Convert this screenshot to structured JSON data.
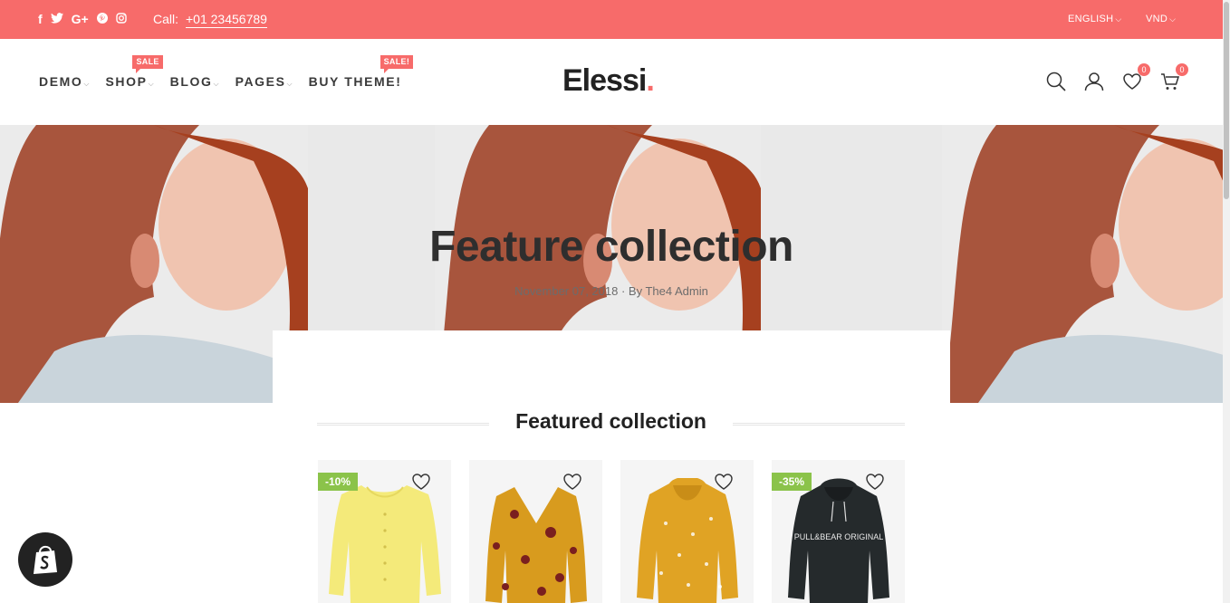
{
  "topbar": {
    "social_icons": [
      "facebook-icon",
      "twitter-icon",
      "google-plus-icon",
      "pinterest-icon",
      "instagram-icon"
    ],
    "social_glyphs": [
      "f",
      "t",
      "G+",
      "p",
      "◎"
    ],
    "call_label": "Call:",
    "phone": "+01 23456789",
    "language": "ENGLISH",
    "currency": "VND"
  },
  "nav": {
    "items": [
      {
        "label": "DEMO"
      },
      {
        "label": "SHOP",
        "badge": "SALE"
      },
      {
        "label": "BLOG"
      },
      {
        "label": "PAGES"
      },
      {
        "label": "BUY THEME!",
        "badge": "SALE!"
      }
    ]
  },
  "logo": {
    "text": "Elessi",
    "dot": "."
  },
  "header_icons": {
    "wishlist_count": "0",
    "cart_count": "0"
  },
  "hero": {
    "title": "Feature collection",
    "meta": "November 07, 2018 · By The4 Admin"
  },
  "featured": {
    "title": "Featured collection",
    "products": [
      {
        "discount": "-10%",
        "color": "#f4ea7a",
        "image": "yellow-sweater"
      },
      {
        "discount": "",
        "color": "#d89b1e",
        "image": "floral-blouse"
      },
      {
        "discount": "",
        "color": "#e0a324",
        "image": "mustard-hoodie"
      },
      {
        "discount": "-35%",
        "color": "#252a2c",
        "image": "black-hoodie",
        "print": "PULL&BEAR ORIGINAL"
      }
    ]
  },
  "colors": {
    "accent": "#f76b6a",
    "sale_green": "#8bc34a"
  }
}
